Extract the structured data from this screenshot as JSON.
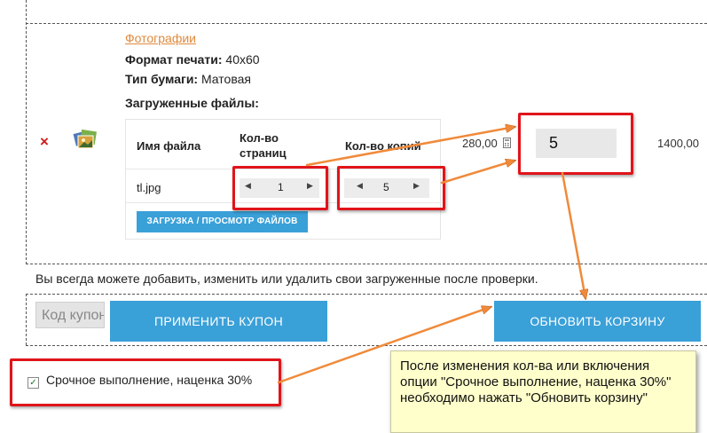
{
  "product": {
    "name": "Фотографии",
    "format_label": "Формат печати:",
    "format_value": "40x60",
    "paper_label": "Тип бумаги:",
    "paper_value": "Матовая",
    "files_heading": "Загруженные файлы:",
    "remove_symbol": "×",
    "price": "280,00",
    "quantity": "5",
    "total": "1400,00"
  },
  "files_table": {
    "col_filename": "Имя файла",
    "col_pages_line1": "Кол-во",
    "col_pages_line2": "страниц",
    "col_copies": "Кол-во копий",
    "rows": [
      {
        "filename": "tl.jpg",
        "pages": "1",
        "copies": "5"
      }
    ],
    "upload_button": "ЗАГРУЗКА / ПРОСМОТР ФАЙЛОВ"
  },
  "notice": "Вы всегда можете добавить, изменить или удалить свои загруженные после проверки.",
  "coupon": {
    "placeholder": "Код купона",
    "apply_button": "ПРИМЕНИТЬ КУПОН"
  },
  "update_cart_button": "ОБНОВИТЬ КОРЗИНУ",
  "urgent": {
    "checked": true,
    "label": "Срочное выполнение, наценка 30%"
  },
  "callout_text": "После изменения кол-ва или включения опции \"Срочное выполнение, наценка 30%\" необходимо нажать \"Обновить корзину\"",
  "colors": {
    "accent_blue": "#3aa0d8",
    "annotation_red": "#e0141a",
    "arrow_orange": "#f08a3a",
    "callout_bg": "#ffffcc",
    "link_orange": "#e08a3c",
    "remove_red": "#d21a1a"
  }
}
